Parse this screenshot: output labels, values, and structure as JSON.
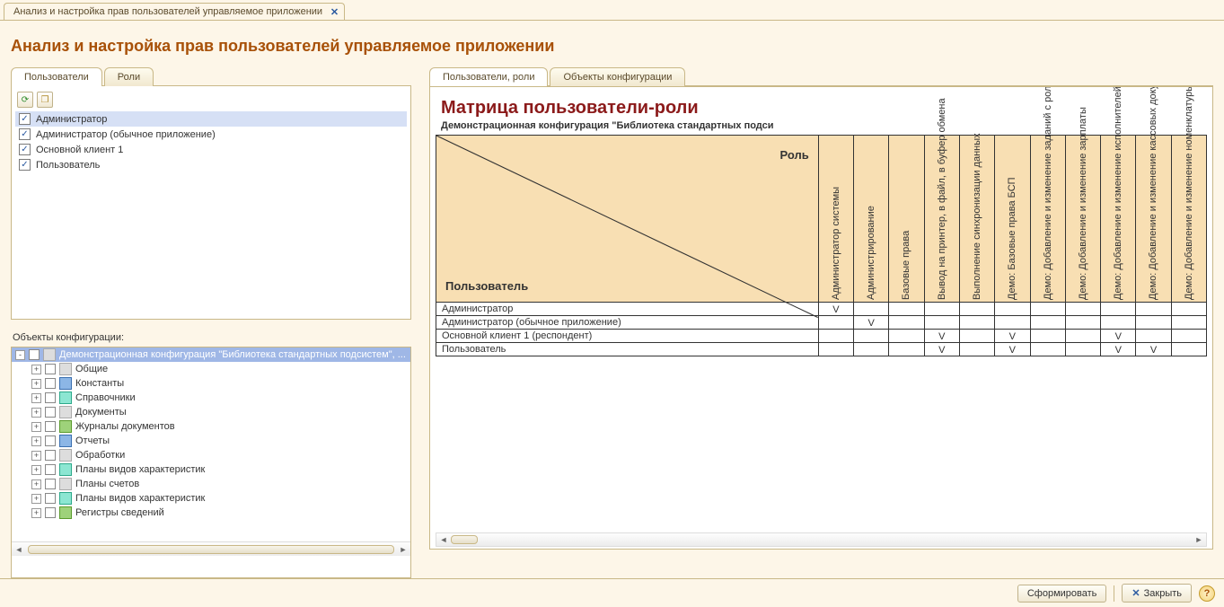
{
  "window": {
    "tab_title": "Анализ и настройка прав пользователей управляемое приложении"
  },
  "page_title": "Анализ и настройка прав пользователей управляемое приложении",
  "left_tabs": {
    "users": "Пользователи",
    "roles": "Роли"
  },
  "users": [
    {
      "label": "Администратор",
      "selected": true
    },
    {
      "label": "Администратор (обычное приложение)",
      "selected": false
    },
    {
      "label": "Основной клиент 1",
      "selected": false
    },
    {
      "label": "Пользователь",
      "selected": false
    }
  ],
  "objects_label": "Объекты конфигурации:",
  "tree": {
    "root": "Демонстрационная конфигурация \"Библиотека стандартных подсистем\", ...",
    "items": [
      "Общие",
      "Константы",
      "Справочники",
      "Документы",
      "Журналы документов",
      "Отчеты",
      "Обработки",
      "Планы видов характеристик",
      "Планы счетов",
      "Планы видов характеристик",
      "Регистры сведений"
    ]
  },
  "right_tabs": {
    "users_roles": "Пользователи, роли",
    "config_objects": "Объекты конфигурации"
  },
  "matrix": {
    "title": "Матрица пользователи-роли",
    "subtitle": "Демонстрационная конфигурация \"Библиотека стандартных подси",
    "corner_role": "Роль",
    "corner_user": "Пользователь",
    "roles": [
      "Администратор системы",
      "Администрирование",
      "Базовые права",
      "Вывод на принтер, в файл, в буфер обмена",
      "Выполнение синхронизации данных",
      "Демо: Базовые права БСП",
      "Демо: Добавление и изменение заданий с ролевой адресацией",
      "Демо: Добавление и изменение зарплаты",
      "Демо: Добавление и изменение исполнителей ролей по объектам адресации",
      "Демо: Добавление и изменение кассовых документов",
      "Демо: Добавление и изменение номенклатуры"
    ],
    "rows": [
      {
        "name": "Администратор",
        "cells": [
          "V",
          "",
          "",
          "",
          "",
          "",
          "",
          "",
          "",
          "",
          ""
        ]
      },
      {
        "name": "Администратор (обычное приложение)",
        "cells": [
          "",
          "V",
          "",
          "",
          "",
          "",
          "",
          "",
          "",
          "",
          ""
        ]
      },
      {
        "name": "Основной клиент 1 (респондент)",
        "cells": [
          "",
          "",
          "",
          "V",
          "",
          "V",
          "",
          "",
          "V",
          "",
          ""
        ]
      },
      {
        "name": "Пользователь",
        "cells": [
          "",
          "",
          "",
          "V",
          "",
          "V",
          "",
          "",
          "V",
          "V",
          ""
        ]
      }
    ]
  },
  "footer": {
    "generate": "Сформировать",
    "close": "Закрыть"
  }
}
